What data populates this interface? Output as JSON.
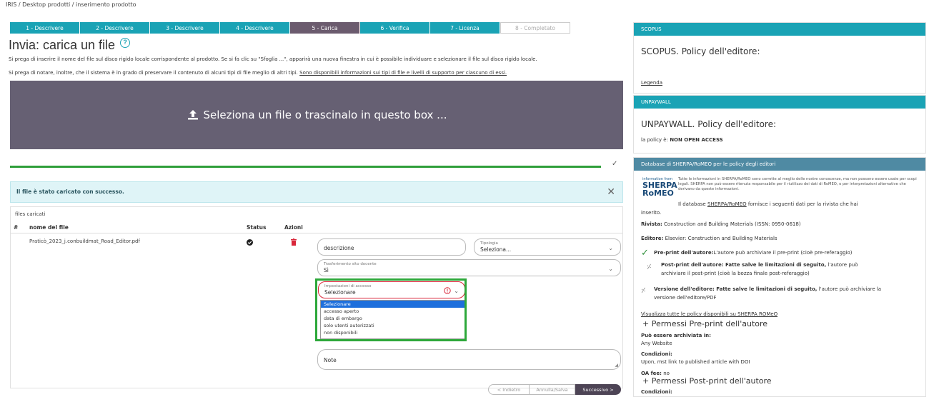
{
  "breadcrumb": "IRIS / Desktop prodotti / inserimento prodotto",
  "steps": [
    "1 - Descrivere",
    "2 - Descrivere",
    "3 - Descrivere",
    "4 - Descrivere",
    "5 - Carica",
    "6 - Verifica",
    "7 - Licenza",
    "8 - Completato"
  ],
  "page_title": "Invia: carica un file",
  "help_symbol": "?",
  "intro_line1": "Si prega di inserire il nome del file sul disco rigido locale corrispondente al prodotto. Se si fa clic su \"Sfoglia ...\", apparirà una nuova finestra in cui è possibile individuare e selezionare il file sul disco rigido locale.",
  "intro_line2_prefix": "Si prega di notare, inoltre, che il sistema è in grado di preservare il contenuto di alcuni tipi di file meglio di altri tipi.",
  "intro_line2_link": "Sono disponibili informazioni sui tipi di file e livelli di supporto per ciascuno di essi.",
  "dropzone_label": "Seleziona un file o trascinalo in questo box ...",
  "alert_text": "Il file è stato caricato con successo.",
  "files": {
    "section_label": "files caricati",
    "col_hash": "#",
    "col_name": "nome del file",
    "col_status": "Status",
    "col_actions": "Azioni",
    "row_filename": "Praticò_2023_j.conbuildmat_Road_Editor.pdf",
    "description_placeholder": "descrizione",
    "tipologia_label": "Tipologia",
    "tipologia_value": "Seleziona...",
    "trasferimento_label": "Trasferimento sito docente",
    "trasferimento_value": "Sì",
    "accesso_label": "Impostazioni di accesso",
    "accesso_value": "Selezionare",
    "accesso_options": [
      "Selezionare",
      "accesso aperto",
      "data di embargo",
      "solo utenti autorizzati",
      "non disponibili"
    ],
    "note_placeholder": "Note"
  },
  "nav": {
    "back": "< Indietro",
    "cancel": "Annulla/Salva",
    "next": "Successivo >"
  },
  "scopus": {
    "header": "SCOPUS",
    "title": "SCOPUS. Policy dell'editore:",
    "legend_link": "Legenda"
  },
  "unpaywall": {
    "header": "UNPAYWALL",
    "title": "UNPAYWALL. Policy dell'editore:",
    "policy_prefix": "la policy è:",
    "policy_value": "NON OPEN ACCESS"
  },
  "sherpa": {
    "header": "Database di SHERPA/RoMEO per le policy degli editori",
    "logo_info": "information from",
    "logo_top": "SHERPA",
    "logo_bottom": "RoMEO",
    "disclaimer": "Tutte le informazioni in SHERPA/RoMEO sono corrette al meglio delle nostre conoscenze, ma non possono essere usate per scopi legali. SHERPA non può essere ritenuta responsabile per il riutilizzo dei dati di RoMEO, o per interpretazioni alternative che derivano da queste informazioni.",
    "db_prefix": "Il database",
    "db_link": "SHERPA/RoMEO",
    "db_suffix": "fornisce i seguenti dati per la rivista che hai",
    "db_suffix2": "inserito.",
    "rivista_label": "Rivista:",
    "rivista_value": "Construction and Building Materials (ISSN: 0950-0618)",
    "editore_label": "Editore:",
    "editore_value": "Elsevier: Construction and Building Materials",
    "preprint_bold": "Pre-print dell'autore:",
    "preprint_text": "L'autore può archiviare il pre-print (cioè pre-referaggio)",
    "postprint_bold": "Post-print dell'autore: Fatte salve le limitazioni di seguito,",
    "postprint_text": "l'autore può",
    "postprint_text2": "archiviare il post-print (cioè la bozza finale post-referaggio)",
    "versione_bold": "Versione dell'editore: Fatte salve le limitazioni di seguito,",
    "versione_text": "l'autore può archiviare la",
    "versione_text2": "versione dell'editore/PDF",
    "all_policies_link": "Visualizza tutte le policy disponibili su SHERPA ROMeO",
    "perm_pre_title": "Permessi Pre-print dell'autore",
    "archive_label": "Può essere archiviata in:",
    "archive_value": "Any Website",
    "conditions_label": "Condizioni:",
    "conditions_value": "Upon, mst link to published article with DOI",
    "oafee_label": "OA fee:",
    "oafee_value": "no",
    "perm_post_title": "Permessi Post-print dell'autore",
    "conditions_label2": "Condizioni:"
  },
  "colors": {
    "teal": "#1aa3b5",
    "active_step": "#6b5b6e",
    "dropzone": "#666073",
    "success_green": "#2e9e3a",
    "highlight_green": "#2da83a",
    "danger_red": "#d9263a"
  }
}
